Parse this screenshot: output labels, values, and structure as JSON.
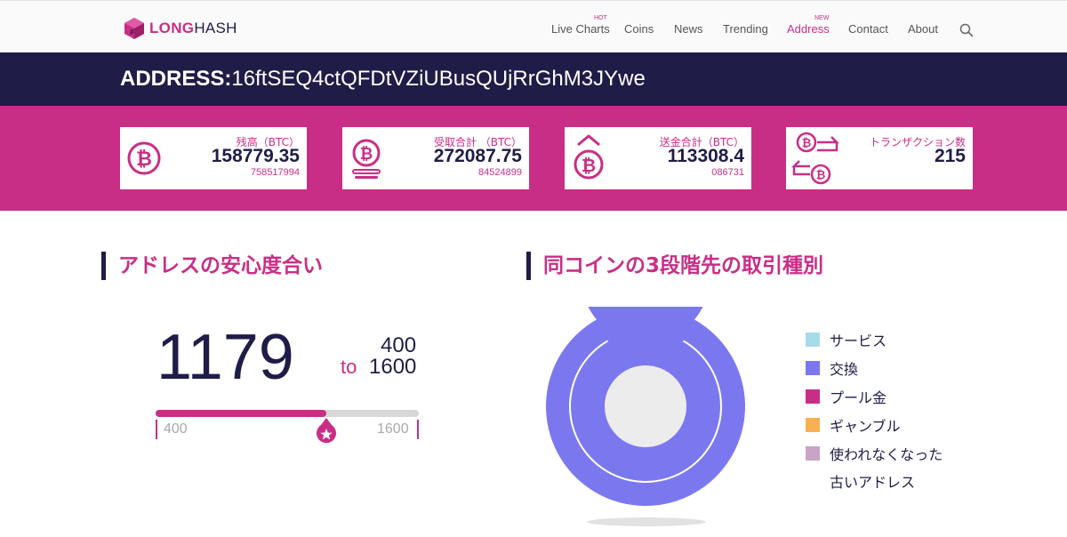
{
  "nav": {
    "logo_long": "LONG",
    "logo_hash": "HASH",
    "items": [
      {
        "label": "Live Charts",
        "badge": "HOT"
      },
      {
        "label": "Coins"
      },
      {
        "label": "News"
      },
      {
        "label": "Trending"
      },
      {
        "label": "Address",
        "badge": "NEW"
      },
      {
        "label": "Contact"
      },
      {
        "label": "About"
      }
    ],
    "search_icon": "search-icon"
  },
  "address": {
    "prefix": "ADDRESS:",
    "value": "16ftSEQ4ctQFDtVZiUBusQUjRrGhM3JYwe"
  },
  "stats": [
    {
      "label": "残高（BTC）",
      "value": "158779.35",
      "sub": "758517994",
      "icon": "bitcoin-icon"
    },
    {
      "label": "受取合計 （BTC）",
      "value": "272087.75",
      "sub": "84524899",
      "icon": "bitcoin-receive-icon"
    },
    {
      "label": "送金合計（BTC）",
      "value": "113308.4",
      "sub": "086731",
      "icon": "bitcoin-send-icon"
    },
    {
      "label": "トランザクション数",
      "value": "215",
      "sub": "",
      "icon": "transaction-exchange-icon"
    }
  ],
  "safety": {
    "title": "アドレスの安心度合い",
    "score": "1179",
    "range_to": "to",
    "range_high": "400",
    "range_low": "1600",
    "axis_min": "400",
    "axis_max": "1600",
    "min": 400,
    "max": 1600,
    "marker_value": 1179
  },
  "chart_section": {
    "title": "同コインの3段階先の取引種別"
  },
  "chart_data": {
    "type": "pie",
    "title": "",
    "categories": [
      "サービス",
      "交換",
      "プール金",
      "ギャンブル",
      "使われなくなった古いアドレス"
    ],
    "rings": [
      {
        "values": [
          0.0,
          98.0,
          0.5,
          1.5,
          0.0
        ]
      },
      {
        "values": [
          0.0,
          100.0,
          0.0,
          0.0,
          0.0
        ]
      },
      {
        "values": [
          0.0,
          100.0,
          0.0,
          0.0,
          0.0
        ]
      }
    ],
    "colors": [
      "#a6dcea",
      "#7b78ef",
      "#c92e86",
      "#f7b151",
      "#c9a4c6"
    ],
    "legend_position": "right",
    "legend": [
      {
        "label": "サービス",
        "color": "#a6dcea"
      },
      {
        "label": "交換",
        "color": "#7b78ef"
      },
      {
        "label": "プール金",
        "color": "#c92e86"
      },
      {
        "label": "ギャンブル",
        "color": "#f7b151"
      },
      {
        "label": "使われなくなった",
        "label2": "古いアドレス",
        "color": "#c9a4c6"
      }
    ]
  }
}
